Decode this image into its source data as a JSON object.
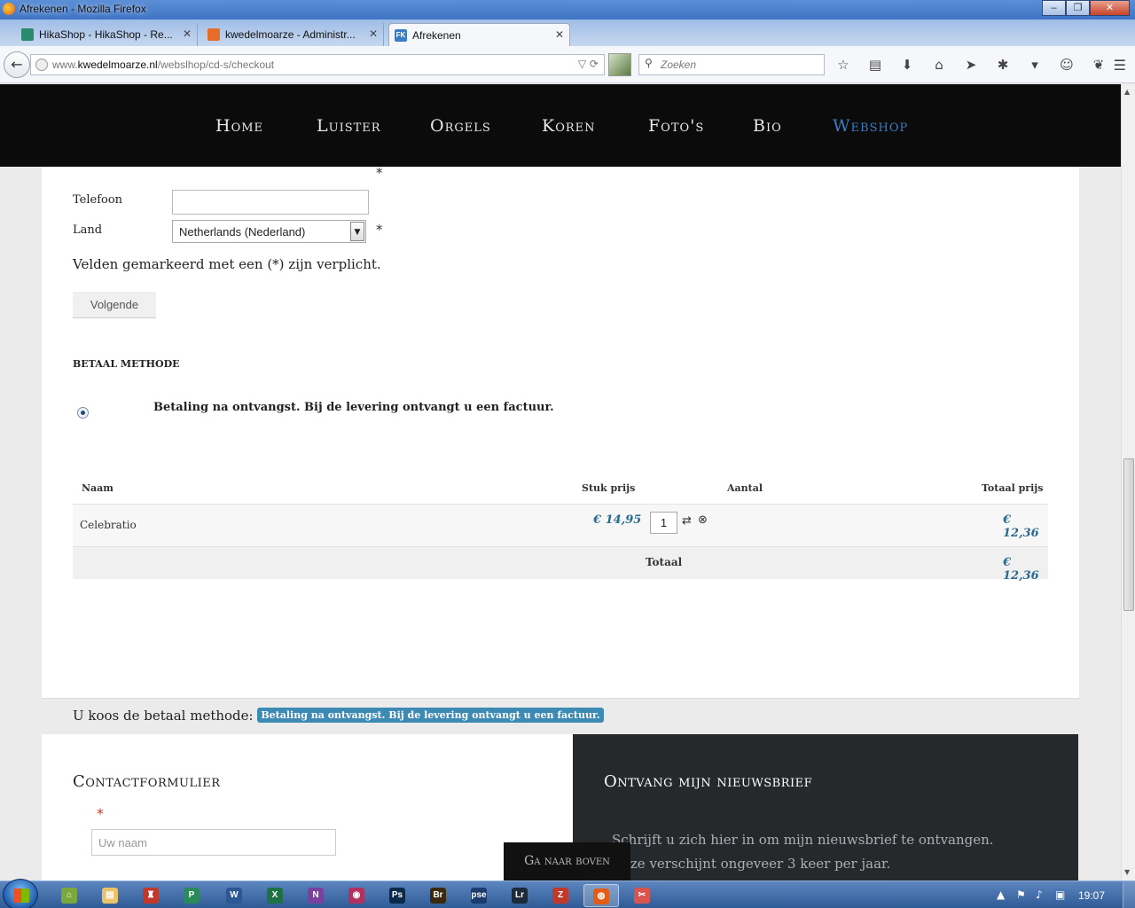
{
  "browser": {
    "window_title": "Afrekenen - Mozilla Firefox",
    "tabs": [
      {
        "label": "HikaShop - HikaShop - Re...",
        "color": "#2b8a6e"
      },
      {
        "label": "kwedelmoarze - Administr...",
        "color": "#e46d2a"
      },
      {
        "label": "Afrekenen",
        "color": "#3b7cc6",
        "icon_text": "FK"
      }
    ],
    "new_tab": "+",
    "url_prefix": "www.",
    "url_host": "kwedelmoarze.nl",
    "url_path": "/webslhop/cd-s/checkout",
    "search_placeholder": "Zoeken"
  },
  "site_nav": {
    "items": [
      "Home",
      "Luister",
      "Orgels",
      "Koren",
      "Foto's",
      "Bio",
      "Webshop"
    ],
    "active": "Webshop",
    "active_color": "#3b7cc6"
  },
  "form": {
    "required_mark": "*",
    "phone_label": "Telefoon",
    "phone_value": "",
    "country_label": "Land",
    "country_value": "Netherlands (Nederland)",
    "required_note": "Velden gemarkeerd met een (*) zijn verplicht.",
    "next_button": "Volgende"
  },
  "payment": {
    "heading": "BETAAL METHODE",
    "option": "Betaling na ontvangst. Bij de levering ontvangt u een factuur.",
    "selected": true
  },
  "cart": {
    "headers": {
      "name": "Naam",
      "unit_price": "Stuk prijs",
      "qty": "Aantal",
      "total_price": "Totaal prijs"
    },
    "rows": [
      {
        "name": "Celebratio",
        "unit_price": "€ 14,95",
        "qty": "1",
        "total_price": "€ 12,36"
      }
    ],
    "total_label": "Totaal",
    "total_value": "€ 12,36"
  },
  "chosen": {
    "prefix": "U koos de betaal methode:",
    "method": "Betaling na ontvangst. Bij de levering ontvangt u een factuur."
  },
  "footer": {
    "contact_heading": "Contactformulier",
    "name_placeholder": "Uw naam",
    "newsletter_heading": "Ontvang mijn nieuwsbrief",
    "newsletter_text": "Schrijft u zich hier in om mijn nieuwsbrief te ontvangen. Deze verschijnt ongeveer 3 keer per jaar.",
    "back_to_top": "Ga naar boven"
  },
  "taskbar": {
    "apps": [
      {
        "name": "explorer-home",
        "glyph": "⌂",
        "color": "#7aa83d"
      },
      {
        "name": "file-explorer",
        "glyph": "▤",
        "color": "#e9c46a"
      },
      {
        "name": "app-manager",
        "glyph": "♜",
        "color": "#c0392b"
      },
      {
        "name": "publisher",
        "glyph": "P",
        "color": "#2a8a5a"
      },
      {
        "name": "word",
        "glyph": "W",
        "color": "#2b5797"
      },
      {
        "name": "excel",
        "glyph": "X",
        "color": "#1e7145"
      },
      {
        "name": "onenote",
        "glyph": "N",
        "color": "#7b3fa0"
      },
      {
        "name": "media",
        "glyph": "◉",
        "color": "#b03060"
      },
      {
        "name": "photoshop",
        "glyph": "Ps",
        "color": "#0b2a4a"
      },
      {
        "name": "bridge",
        "glyph": "Br",
        "color": "#3a2a10"
      },
      {
        "name": "photoshop-elements",
        "glyph": "pse",
        "color": "#1a3d6e"
      },
      {
        "name": "lightroom",
        "glyph": "Lr",
        "color": "#1c2a3a"
      },
      {
        "name": "filezilla",
        "glyph": "Z",
        "color": "#c0392b"
      },
      {
        "name": "firefox",
        "glyph": "◍",
        "color": "#e35d14"
      },
      {
        "name": "snipping-tool",
        "glyph": "✂",
        "color": "#d9534f"
      }
    ],
    "clock": "19:07"
  }
}
